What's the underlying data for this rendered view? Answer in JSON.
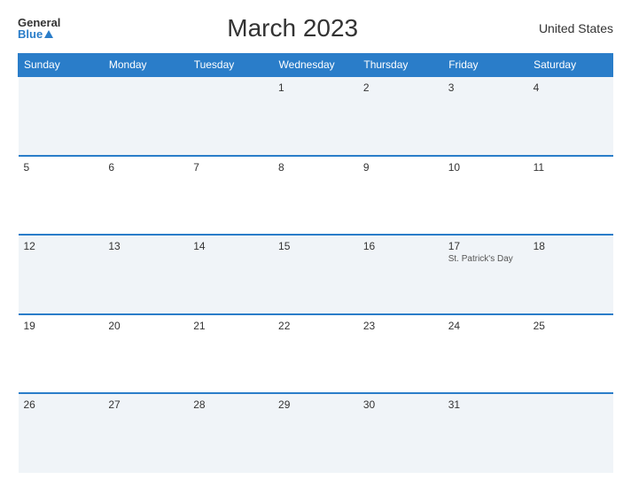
{
  "header": {
    "logo_general": "General",
    "logo_blue": "Blue",
    "title": "March 2023",
    "country": "United States"
  },
  "days_of_week": [
    "Sunday",
    "Monday",
    "Tuesday",
    "Wednesday",
    "Thursday",
    "Friday",
    "Saturday"
  ],
  "weeks": [
    [
      {
        "day": "",
        "event": ""
      },
      {
        "day": "",
        "event": ""
      },
      {
        "day": "",
        "event": ""
      },
      {
        "day": "1",
        "event": ""
      },
      {
        "day": "2",
        "event": ""
      },
      {
        "day": "3",
        "event": ""
      },
      {
        "day": "4",
        "event": ""
      }
    ],
    [
      {
        "day": "5",
        "event": ""
      },
      {
        "day": "6",
        "event": ""
      },
      {
        "day": "7",
        "event": ""
      },
      {
        "day": "8",
        "event": ""
      },
      {
        "day": "9",
        "event": ""
      },
      {
        "day": "10",
        "event": ""
      },
      {
        "day": "11",
        "event": ""
      }
    ],
    [
      {
        "day": "12",
        "event": ""
      },
      {
        "day": "13",
        "event": ""
      },
      {
        "day": "14",
        "event": ""
      },
      {
        "day": "15",
        "event": ""
      },
      {
        "day": "16",
        "event": ""
      },
      {
        "day": "17",
        "event": "St. Patrick's Day"
      },
      {
        "day": "18",
        "event": ""
      }
    ],
    [
      {
        "day": "19",
        "event": ""
      },
      {
        "day": "20",
        "event": ""
      },
      {
        "day": "21",
        "event": ""
      },
      {
        "day": "22",
        "event": ""
      },
      {
        "day": "23",
        "event": ""
      },
      {
        "day": "24",
        "event": ""
      },
      {
        "day": "25",
        "event": ""
      }
    ],
    [
      {
        "day": "26",
        "event": ""
      },
      {
        "day": "27",
        "event": ""
      },
      {
        "day": "28",
        "event": ""
      },
      {
        "day": "29",
        "event": ""
      },
      {
        "day": "30",
        "event": ""
      },
      {
        "day": "31",
        "event": ""
      },
      {
        "day": "",
        "event": ""
      }
    ]
  ]
}
